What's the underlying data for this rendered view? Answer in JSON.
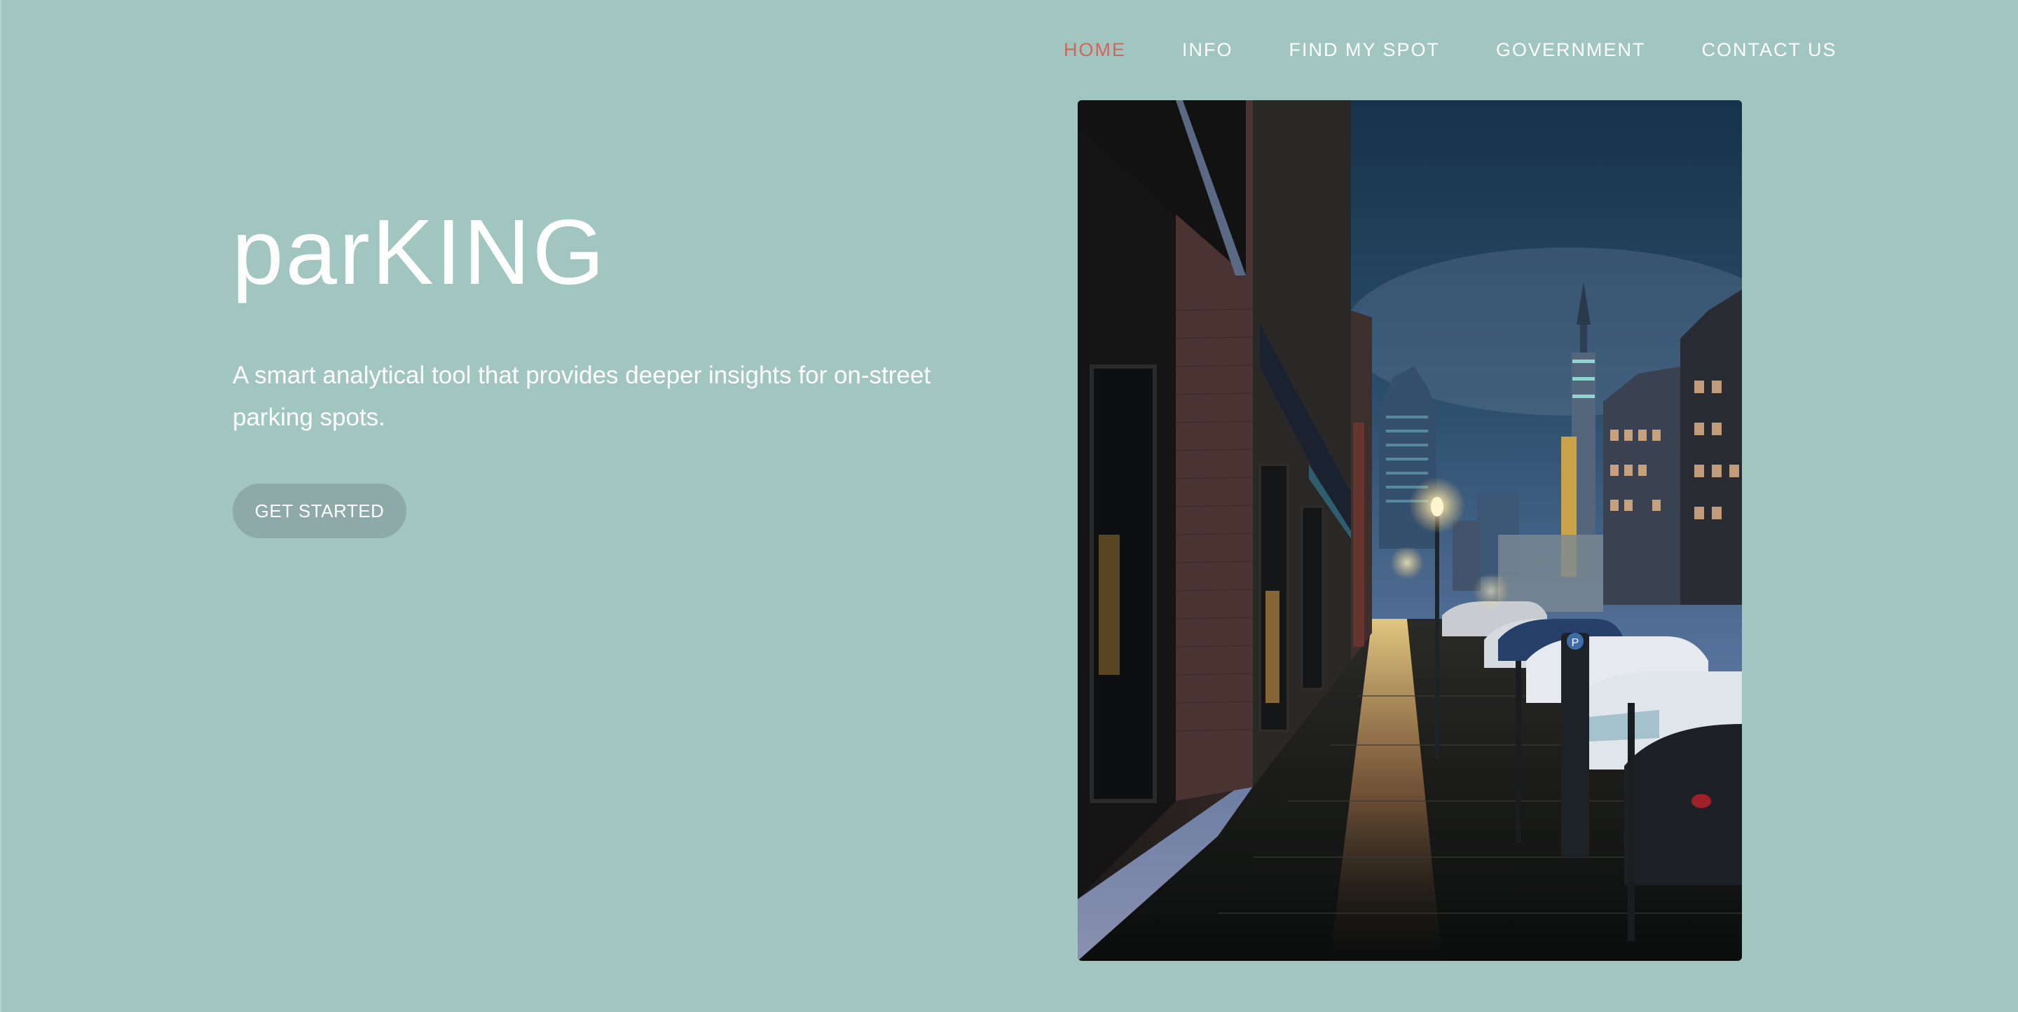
{
  "nav": {
    "items": [
      {
        "label": "HOME",
        "active": true
      },
      {
        "label": "INFO",
        "active": false
      },
      {
        "label": "FIND MY SPOT",
        "active": false
      },
      {
        "label": "GOVERNMENT",
        "active": false
      },
      {
        "label": "CONTACT US",
        "active": false
      }
    ],
    "active_color": "#d9625c"
  },
  "hero": {
    "title": "parKING",
    "description": "A smart analytical tool that provides deeper insights for on-street parking spots.",
    "cta_label": "GET STARTED"
  },
  "colors": {
    "background": "#a0c6bf",
    "button": "#8eaaa8",
    "text": "#ffffff"
  },
  "photo": {
    "parking_sign": "P"
  }
}
